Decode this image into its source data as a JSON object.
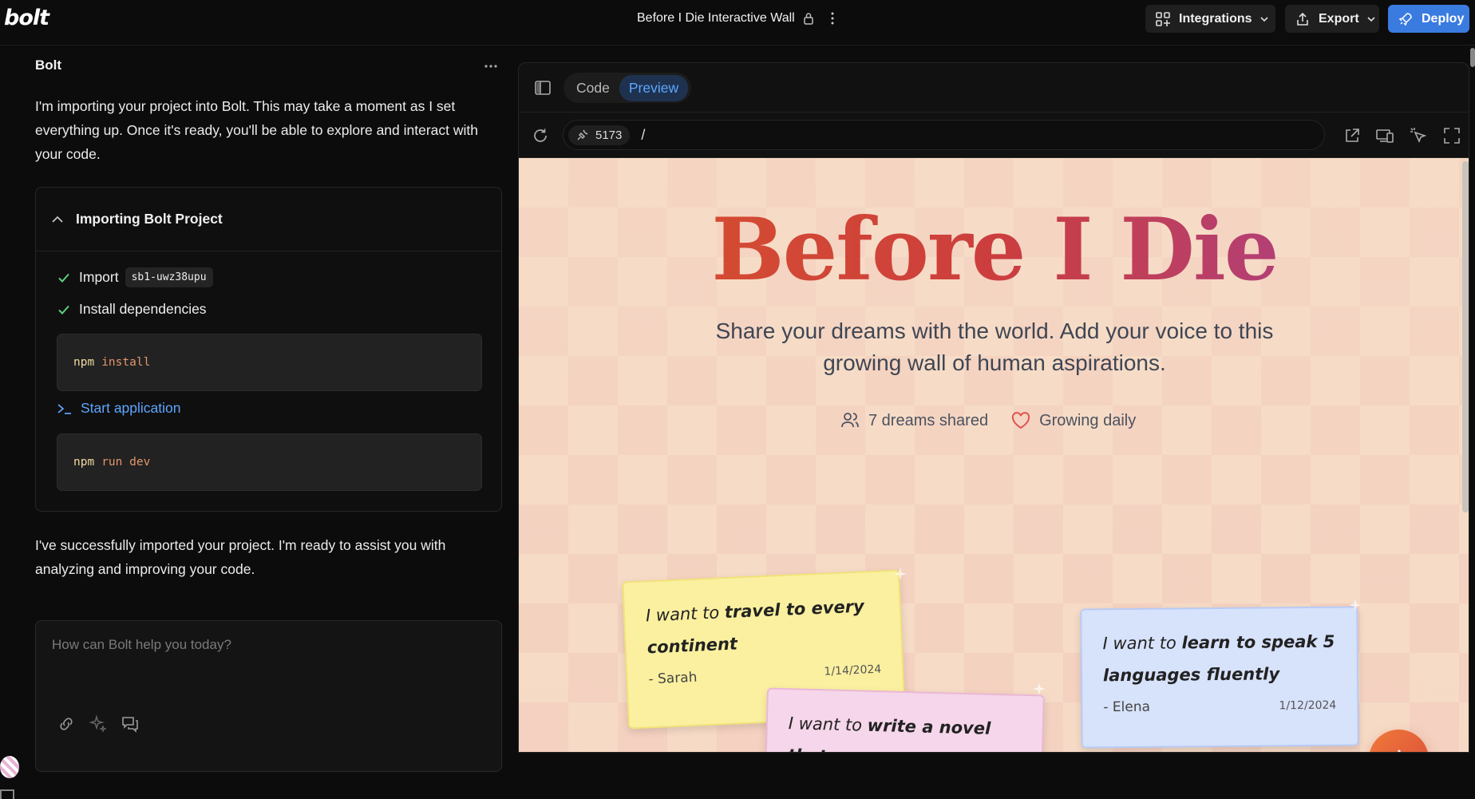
{
  "app": {
    "logo": "bolt",
    "project_title": "Before I Die Interactive Wall",
    "buttons": {
      "integrations": "Integrations",
      "export": "Export",
      "deploy": "Deploy"
    }
  },
  "chat": {
    "header": "Bolt",
    "message1": "I'm importing your project into Bolt. This may take a moment as I set everything up. Once it's ready, you'll be able to explore and interact with your code.",
    "import_card": {
      "title": "Importing Bolt Project",
      "steps": [
        {
          "label": "Import",
          "chip": "sb1-uwz38upu"
        },
        {
          "label": "Install dependencies"
        },
        {
          "label": "Start application"
        }
      ],
      "commands": [
        {
          "cmd": "npm",
          "args": "install"
        },
        {
          "cmd": "npm",
          "args": "run dev"
        }
      ]
    },
    "message2": "I've successfully imported your project. I'm ready to assist you with analyzing and improving your code.",
    "prompt_placeholder": "How can Bolt help you today?"
  },
  "preview": {
    "tabs": {
      "code": "Code",
      "preview": "Preview"
    },
    "active_tab": "Preview",
    "port": "5173",
    "path": "/"
  },
  "site": {
    "title": "Before I Die",
    "subtitle": "Share your dreams with the world. Add your voice to this growing wall of human aspirations.",
    "stats": {
      "shared": "7 dreams shared",
      "growing": "Growing daily"
    },
    "notes": [
      {
        "prefix": "I want to",
        "dream": "travel to every continent",
        "author": "- Sarah",
        "date": "1/14/2024"
      },
      {
        "prefix": "I want to",
        "dream": "write a novel that",
        "author": "",
        "date": ""
      },
      {
        "prefix": "I want to",
        "dream": "learn to speak 5 languages fluently",
        "author": "- Elena",
        "date": "1/12/2024"
      }
    ]
  },
  "colors": {
    "accent_blue": "#3a7be0",
    "link_blue": "#5ea6ff",
    "check_green": "#5cd07a",
    "title_gradient_start": "#d9542a",
    "title_gradient_end": "#a2409a"
  }
}
